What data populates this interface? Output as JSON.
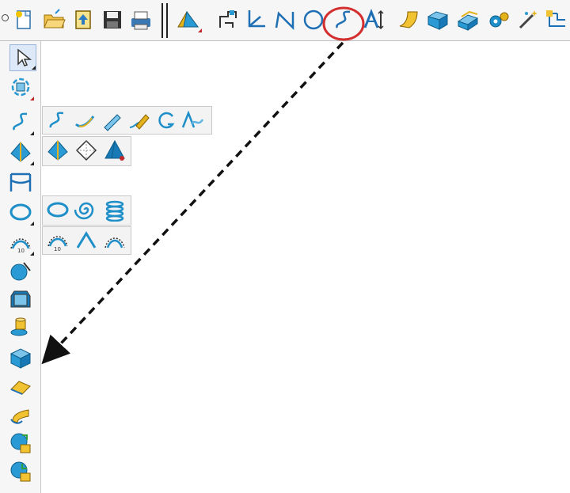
{
  "toolbar": {
    "icons": [
      "new-file-icon",
      "open-folder-icon",
      "upload-icon",
      "save-icon",
      "print-icon",
      "tent-surface-icon",
      "copy-shape-icon",
      "coordinate-axes-icon",
      "polyline-icon",
      "circle-icon",
      "spline-curve-icon",
      "text-icon",
      "surface-patch-icon",
      "box-solid-icon",
      "stacked-solid-icon",
      "gear-settings-icon",
      "magic-wand-icon",
      "network-icon"
    ],
    "highlighted": "spline-curve-icon",
    "highlight_color": "#d32f2f"
  },
  "left_toolbar": {
    "icons": [
      "select-arrow-icon",
      "view-rotate-icon",
      "curve-icon",
      "triangle-surface-icon",
      "frame-icon",
      "ellipse-icon",
      "arc-dimension-icon",
      "sphere-icon",
      "cube-icon",
      "cylinder-icon",
      "box-split-icon",
      "fold-surface-icon",
      "bent-surface-icon",
      "globe-import-icon",
      "globe-export-icon"
    ]
  },
  "flyouts": {
    "curves": [
      "spline-icon",
      "curve-3d-icon",
      "pen-curve-icon",
      "pen-edit-curve-icon",
      "helix-open-icon",
      "text-curve-icon"
    ],
    "surfaces": [
      "triangle-surface-icon",
      "diamond-surface-icon",
      "pyramid-surface-icon"
    ],
    "ellipses": [
      "ellipse-icon",
      "spiral-icon",
      "coil-icon"
    ],
    "arcs": [
      "arc-dimension-icon",
      "arc-icon",
      "arc-points-icon"
    ]
  },
  "annotation": {
    "arrow_color": "#111111"
  }
}
